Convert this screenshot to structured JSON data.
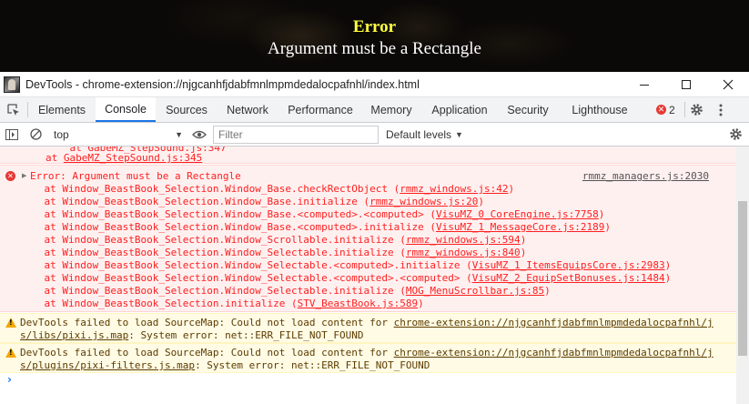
{
  "game": {
    "title": "Error",
    "title_color": "#ffff40",
    "message": "Argument must be a Rectangle"
  },
  "window": {
    "title": "DevTools - chrome-extension://njgcanhfjdabfmnlmpmdedalocpafnhl/index.html"
  },
  "tabs": [
    "Elements",
    "Console",
    "Sources",
    "Network",
    "Performance",
    "Memory",
    "Application",
    "Security",
    "Lighthouse"
  ],
  "active_tab": "Console",
  "error_count": "2",
  "toolbar": {
    "context": "top",
    "filter_placeholder": "Filter",
    "levels": "Default levels"
  },
  "console": {
    "prev_partial": "at GabeMZ_StepSound.js:345",
    "prev_partial_prefix": "at ",
    "prev_partial_link": "GabeMZ_StepSound.js:345",
    "error": {
      "message": "Error: Argument must be a Rectangle",
      "source": "rmmz_managers.js:2030",
      "stack": [
        {
          "prefix": "    at Window_BeastBook_Selection.Window_Base.checkRectObject (",
          "link": "rmmz_windows.js:42",
          "suffix": ")"
        },
        {
          "prefix": "    at Window_BeastBook_Selection.Window_Base.initialize (",
          "link": "rmmz_windows.js:20",
          "suffix": ")"
        },
        {
          "prefix": "    at Window_BeastBook_Selection.Window_Base.<computed>.<computed> (",
          "link": "VisuMZ_0_CoreEngine.js:7758",
          "suffix": ")"
        },
        {
          "prefix": "    at Window_BeastBook_Selection.Window_Base.<computed>.initialize (",
          "link": "VisuMZ_1_MessageCore.js:2189",
          "suffix": ")"
        },
        {
          "prefix": "    at Window_BeastBook_Selection.Window_Scrollable.initialize (",
          "link": "rmmz_windows.js:594",
          "suffix": ")"
        },
        {
          "prefix": "    at Window_BeastBook_Selection.Window_Selectable.initialize (",
          "link": "rmmz_windows.js:840",
          "suffix": ")"
        },
        {
          "prefix": "    at Window_BeastBook_Selection.Window_Selectable.<computed>.initialize (",
          "link": "VisuMZ_1_ItemsEquipsCore.js:2983",
          "suffix": ")"
        },
        {
          "prefix": "    at Window_BeastBook_Selection.Window_Selectable.<computed>.<computed> (",
          "link": "VisuMZ_2_EquipSetBonuses.js:1484",
          "suffix": ")"
        },
        {
          "prefix": "    at Window_BeastBook_Selection.Window_Selectable.initialize (",
          "link": "MOG_MenuScrollbar.js:85",
          "suffix": ")"
        },
        {
          "prefix": "    at Window_BeastBook_Selection.initialize (",
          "link": "STV_BeastBook.js:589",
          "suffix": ")"
        }
      ]
    },
    "warnings": [
      {
        "prefix": "DevTools failed to load SourceMap: Could not load content for ",
        "link1": "chrome-extension://njgcanhfjdabfmnlmpmdedalocpafnhl/j",
        "link2": "s/libs/pixi.js.map",
        "suffix": ": System error: net::ERR_FILE_NOT_FOUND"
      },
      {
        "prefix": "DevTools failed to load SourceMap: Could not load content for ",
        "link1": "chrome-extension://njgcanhfjdabfmnlmpmdedalocpafnhl/j",
        "link2": "s/plugins/pixi-filters.js.map",
        "suffix": ": System error: net::ERR_FILE_NOT_FOUND"
      }
    ],
    "prompt": "›"
  }
}
